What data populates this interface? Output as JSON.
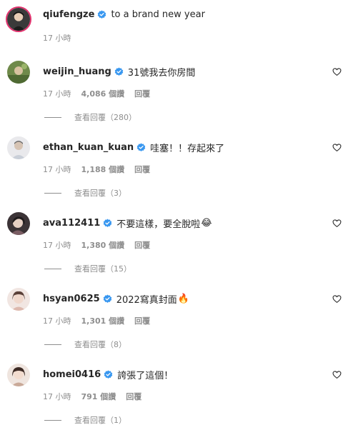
{
  "caption": {
    "username": "qiufengze",
    "text": "to a brand new year",
    "time": "17 小時"
  },
  "comments": [
    {
      "username": "weijin_huang",
      "text": "31號我去你房間",
      "time": "17 小時",
      "likes": "4,086 個讚",
      "reply": "回覆",
      "view_replies": "查看回覆（280）"
    },
    {
      "username": "ethan_kuan_kuan",
      "text": "哇塞！！存起來了",
      "time": "17 小時",
      "likes": "1,188 個讚",
      "reply": "回覆",
      "view_replies": "查看回覆（3）"
    },
    {
      "username": "ava112411",
      "text": "不要這樣，要全脫啦",
      "emoji": "😂",
      "time": "17 小時",
      "likes": "1,380 個讚",
      "reply": "回覆",
      "view_replies": "查看回覆（15）"
    },
    {
      "username": "hsyan0625",
      "text": "2022寫真封面",
      "emoji": "🔥",
      "time": "17 小時",
      "likes": "1,301 個讚",
      "reply": "回覆",
      "view_replies": "查看回覆（8）"
    },
    {
      "username": "homei0416",
      "text": "誇張了這個！",
      "time": "17 小時",
      "likes": "791 個讚",
      "reply": "回覆",
      "view_replies": "查看回覆（1）"
    }
  ],
  "colors": {
    "verified": "#3897f0",
    "secondary_text": "#8e8e8e",
    "primary_text": "#262626"
  },
  "icons": {
    "verified": "verified-badge-icon",
    "like": "heart-outline-icon"
  }
}
